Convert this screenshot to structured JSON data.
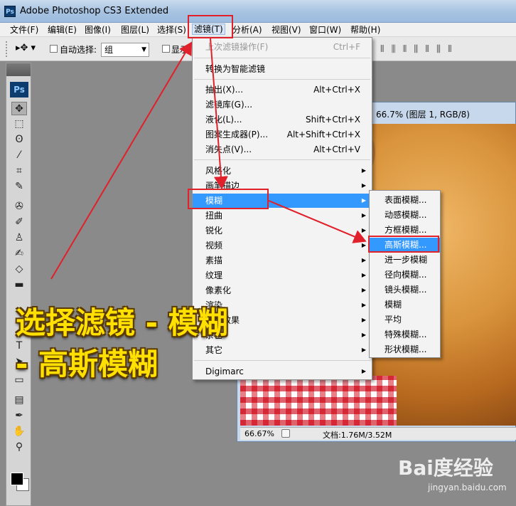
{
  "window": {
    "title": "Adobe Photoshop CS3 Extended",
    "app_icon": "Ps"
  },
  "menubar": [
    "文件(F)",
    "编辑(E)",
    "图像(I)",
    "图层(L)",
    "选择(S)",
    "滤镜(T)",
    "分析(A)",
    "视图(V)",
    "窗口(W)",
    "帮助(H)"
  ],
  "options": {
    "auto_select_label": "自动选择:",
    "auto_select_value": "组",
    "show_label": "显示"
  },
  "tools": {
    "logo": "Ps"
  },
  "document": {
    "title": "66.7% (图层 1, RGB/8)",
    "zoom": "66.67%",
    "doc_info": "文档:1.76M/3.52M"
  },
  "filter_menu": {
    "last_filter": {
      "label": "上次滤镜操作(F)",
      "shortcut": "Ctrl+F"
    },
    "smart_filter": "转换为智能滤镜",
    "group1": [
      {
        "label": "抽出(X)...",
        "shortcut": "Alt+Ctrl+X"
      },
      {
        "label": "滤镜库(G)...",
        "shortcut": ""
      },
      {
        "label": "液化(L)...",
        "shortcut": "Shift+Ctrl+X"
      },
      {
        "label": "图案生成器(P)...",
        "shortcut": "Alt+Shift+Ctrl+X"
      },
      {
        "label": "消失点(V)...",
        "shortcut": "Alt+Ctrl+V"
      }
    ],
    "group2": [
      "风格化",
      "画笔描边",
      "模糊",
      "扭曲",
      "锐化",
      "视频",
      "素描",
      "纹理",
      "像素化",
      "渲染",
      "艺术效果",
      "杂色",
      "其它"
    ],
    "digimarc": "Digimarc"
  },
  "blur_submenu": [
    "表面模糊...",
    "动感模糊...",
    "方框模糊...",
    "高斯模糊...",
    "进一步模糊",
    "径向模糊...",
    "镜头模糊...",
    "模糊",
    "平均",
    "特殊模糊...",
    "形状模糊..."
  ],
  "annotation": {
    "line1": "选择滤镜 - 模糊",
    "line2": "- 高斯模糊"
  },
  "watermark": {
    "logo": "Bai度经验",
    "url": "jingyan.baidu.com"
  }
}
